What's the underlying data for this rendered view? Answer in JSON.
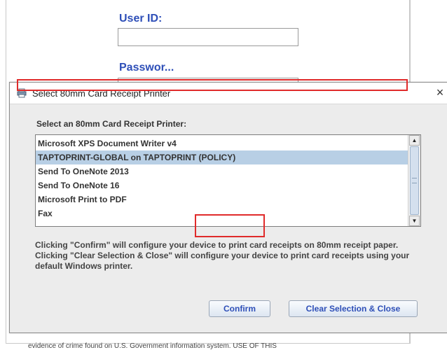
{
  "login": {
    "user_id_label": "User ID:",
    "password_label": "Passwor...",
    "disclaimer": "evidence of crime found on U.S. Government information system. USE OF THIS"
  },
  "dialog": {
    "title": "Select 80mm Card Receipt Printer",
    "close_glyph": "×",
    "prompt": "Select an 80mm Card Receipt Printer:",
    "printers": [
      "Microsoft XPS Document Writer v4",
      "TAPTOPRINT-GLOBAL on TAPTOPRINT (POLICY)",
      "Send To OneNote 2013",
      "Send To OneNote 16",
      "Microsoft Print to PDF",
      "Fax"
    ],
    "selected_index": 1,
    "info_text": "Clicking \"Confirm\" will configure your device to print card receipts on 80mm receipt paper.\nClicking \"Clear Selection & Close\" will configure your device to print card receipts using your default Windows printer.",
    "confirm_label": "Confirm",
    "clear_label": "Clear Selection & Close",
    "scroll_up_glyph": "▲",
    "scroll_down_glyph": "▼",
    "icons": {
      "title": "printer-icon",
      "close": "close-icon"
    },
    "colors": {
      "highlight": "#e02b2b",
      "selection": "#b8cfe5",
      "label_blue": "#2e4fb8"
    }
  }
}
